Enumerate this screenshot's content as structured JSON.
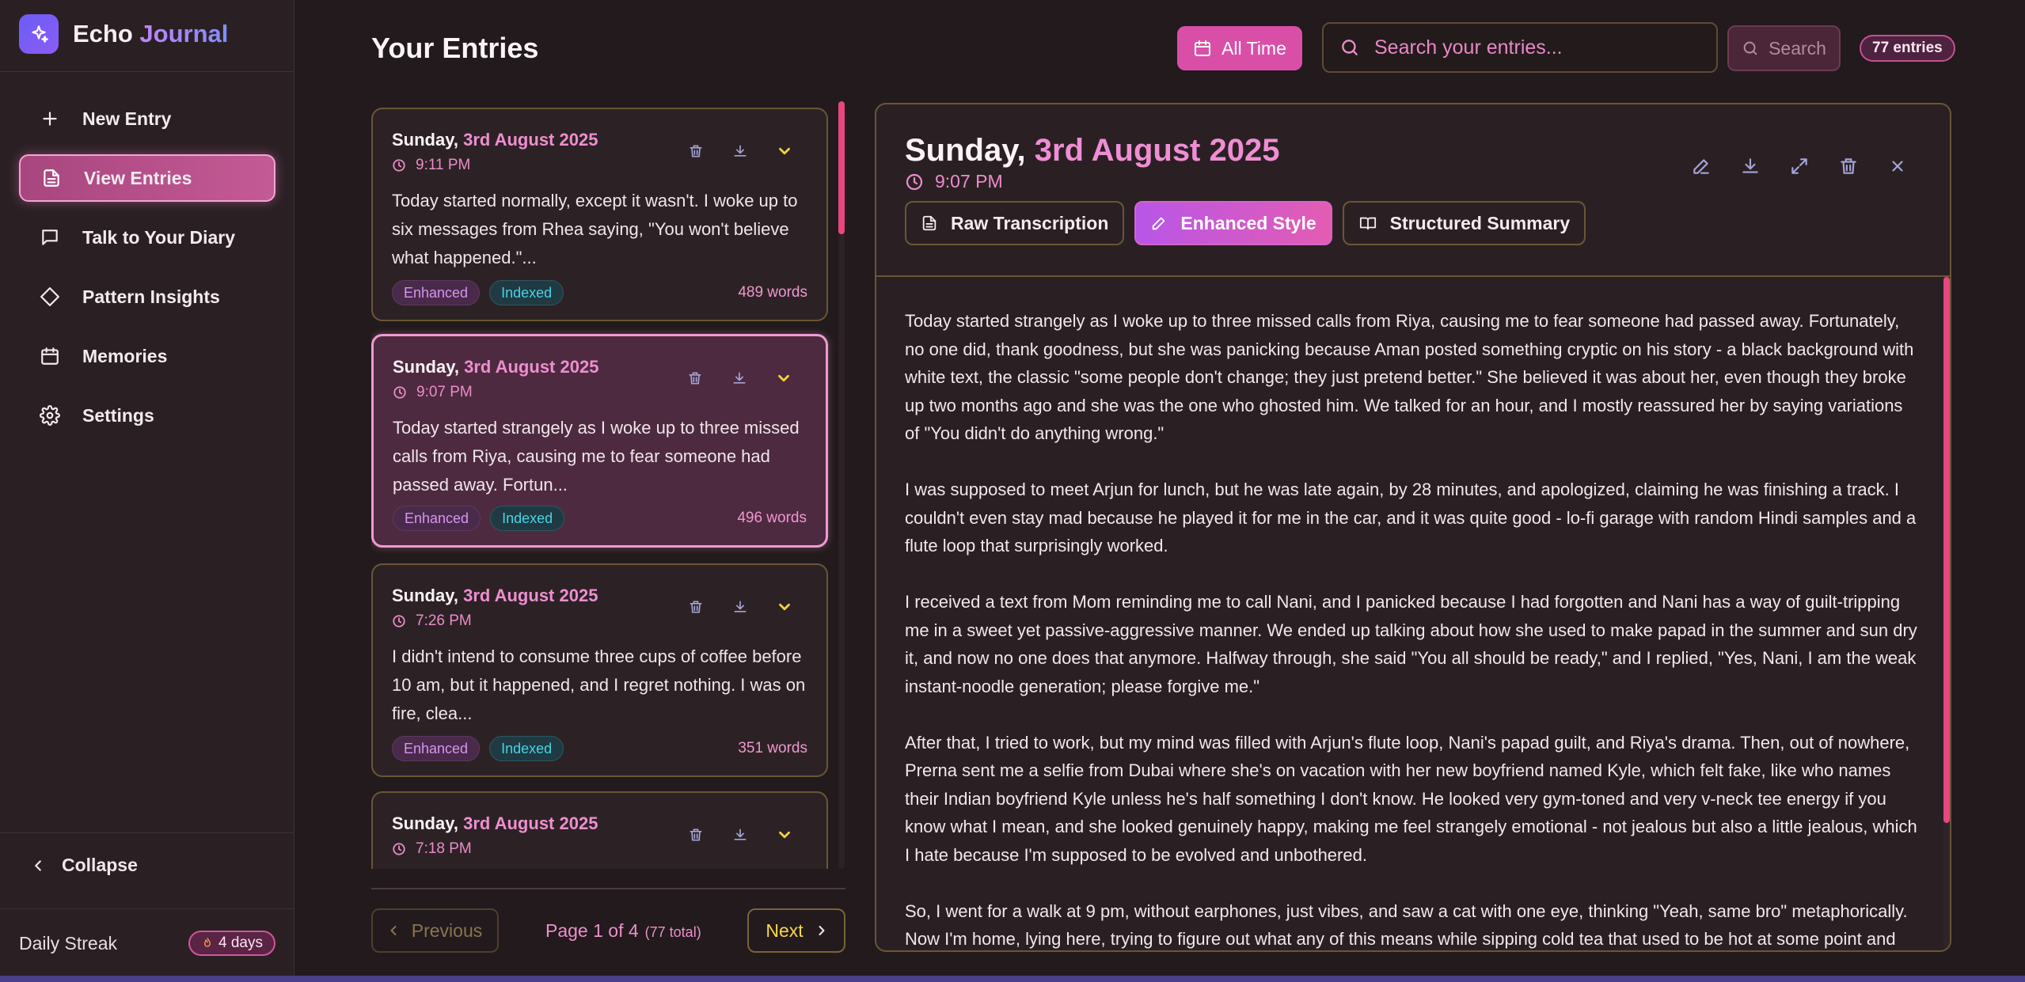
{
  "app": {
    "name_part1": "Echo",
    "name_part2": "Journal"
  },
  "sidebar": {
    "items": [
      {
        "label": "New Entry",
        "icon": "plus-icon"
      },
      {
        "label": "View Entries",
        "icon": "document-icon",
        "active": true
      },
      {
        "label": "Talk to Your Diary",
        "icon": "chat-icon"
      },
      {
        "label": "Pattern Insights",
        "icon": "diamond-icon"
      },
      {
        "label": "Memories",
        "icon": "calendar-icon"
      },
      {
        "label": "Settings",
        "icon": "gear-icon"
      }
    ],
    "collapse_label": "Collapse",
    "streak_label": "Daily Streak",
    "streak_value": "4 days"
  },
  "header": {
    "title": "Your Entries",
    "filter_label": "All Time",
    "search_placeholder": "Search your entries...",
    "search_button": "Search",
    "entries_count": "77 entries"
  },
  "entries": [
    {
      "weekday": "Sunday,",
      "date": "3rd August 2025",
      "time": "9:11 PM",
      "excerpt": "Today started normally, except it wasn't. I woke up to six messages from Rhea saying, \"You won't believe what happened.\"...",
      "tags": [
        "Enhanced",
        "Indexed"
      ],
      "words": "489 words"
    },
    {
      "weekday": "Sunday,",
      "date": "3rd August 2025",
      "time": "9:07 PM",
      "excerpt": "Today started strangely as I woke up to three missed calls from Riya, causing me to fear someone had passed away. Fortun...",
      "tags": [
        "Enhanced",
        "Indexed"
      ],
      "words": "496 words"
    },
    {
      "weekday": "Sunday,",
      "date": "3rd August 2025",
      "time": "7:26 PM",
      "excerpt": "I didn't intend to consume three cups of coffee before 10 am, but it happened, and I regret nothing. I was on fire, clea...",
      "tags": [
        "Enhanced",
        "Indexed"
      ],
      "words": "351 words"
    },
    {
      "weekday": "Sunday,",
      "date": "3rd August 2025",
      "time": "7:18 PM",
      "excerpt": "",
      "tags": [],
      "words": ""
    }
  ],
  "pagination": {
    "previous": "Previous",
    "page_text": "Page 1 of 4",
    "total_text": "(77 total)",
    "next": "Next"
  },
  "detail": {
    "weekday": "Sunday,",
    "date": "3rd August 2025",
    "time": "9:07 PM",
    "tabs": [
      {
        "label": "Raw Transcription",
        "icon": "document-icon"
      },
      {
        "label": "Enhanced Style",
        "icon": "pencil-icon",
        "active": true
      },
      {
        "label": "Structured Summary",
        "icon": "book-icon"
      }
    ],
    "paragraphs": [
      "Today started strangely as I woke up to three missed calls from Riya, causing me to fear someone had passed away. Fortunately, no one did, thank goodness, but she was panicking because Aman posted something cryptic on his story - a black background with white text, the classic \"some people don't change; they just pretend better.\" She believed it was about her, even though they broke up two months ago and she was the one who ghosted him. We talked for an hour, and I mostly reassured her by saying variations of \"You didn't do anything wrong.\"",
      "I was supposed to meet Arjun for lunch, but he was late again, by 28 minutes, and apologized, claiming he was finishing a track. I couldn't even stay mad because he played it for me in the car, and it was quite good - lo-fi garage with random Hindi samples and a flute loop that surprisingly worked.",
      "I received a text from Mom reminding me to call Nani, and I panicked because I had forgotten and Nani has a way of guilt-tripping me in a sweet yet passive-aggressive manner. We ended up talking about how she used to make papad in the summer and sun dry it, and now no one does that anymore. Halfway through, she said \"You all should be ready,\" and I replied, \"Yes, Nani, I am the weak instant-noodle generation; please forgive me.\"",
      "After that, I tried to work, but my mind was filled with Arjun's flute loop, Nani's papad guilt, and Riya's drama. Then, out of nowhere, Prerna sent me a selfie from Dubai where she's on vacation with her new boyfriend named Kyle, which felt fake, like who names their Indian boyfriend Kyle unless he's half something I don't know. He looked very gym-toned and very v-neck tee energy if you know what I mean, and she looked genuinely happy, making me feel strangely emotional - not jealous but also a little jealous, which I hate because I'm supposed to be evolved and unbothered.",
      "So, I went for a walk at 9 pm, without earphones, just vibes, and saw a cat with one eye, thinking \"Yeah, same bro\" metaphorically. Now I'm home, lying here, trying to figure out what any of this means while sipping cold tea that used to be hot at some point and"
    ]
  },
  "colors": {
    "accent_pink": "#d94fa8",
    "highlight_pink": "#ef8ed4",
    "tag_indexed": "#48d3e6",
    "next_yellow": "#fbd74a",
    "scroll_thumb": "#e7467f"
  }
}
